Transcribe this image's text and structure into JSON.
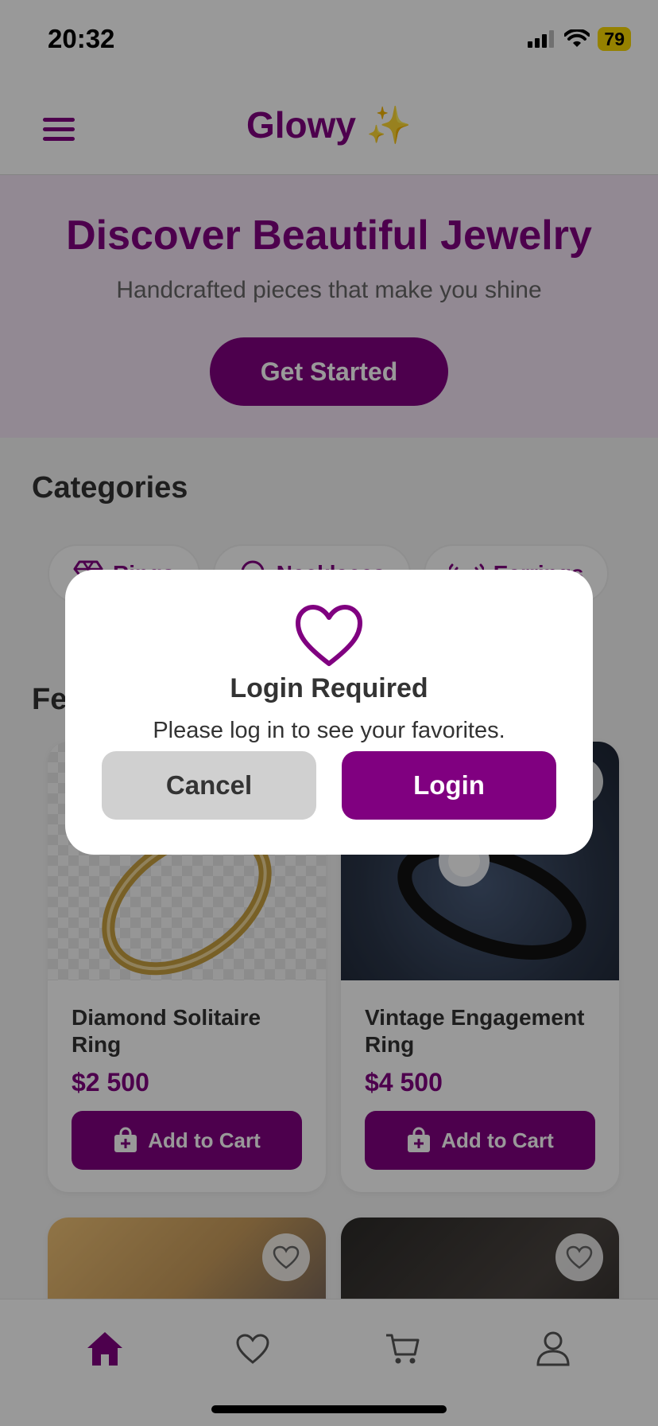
{
  "status_bar": {
    "time": "20:32",
    "battery": "79"
  },
  "header": {
    "brand": "Glowy ✨"
  },
  "hero": {
    "title": "Discover Beautiful Jewelry",
    "subtitle": "Handcrafted pieces that make you shine",
    "cta": "Get Started"
  },
  "categories": {
    "title": "Categories",
    "items": [
      {
        "label": "Rings",
        "icon": "gem-icon"
      },
      {
        "label": "Necklaces",
        "icon": "necklace-icon"
      },
      {
        "label": "Earrings",
        "icon": "earrings-icon"
      }
    ]
  },
  "featured": {
    "title": "Featured"
  },
  "products": [
    {
      "name": "Diamond Solitaire Ring",
      "price": "$2 500",
      "button": "Add to Cart"
    },
    {
      "name": "Vintage Engagement Ring",
      "price": "$4 500",
      "button": "Add to Cart"
    }
  ],
  "bottom_nav": [
    "home-icon",
    "heart-icon",
    "cart-icon",
    "user-icon"
  ],
  "modal": {
    "icon": "heart-icon",
    "title": "Login Required",
    "message": "Please log in to see your favorites.",
    "cancel": "Cancel",
    "login": "Login"
  },
  "colors": {
    "accent": "#800080",
    "hero_bg": "#f3e5f5"
  }
}
